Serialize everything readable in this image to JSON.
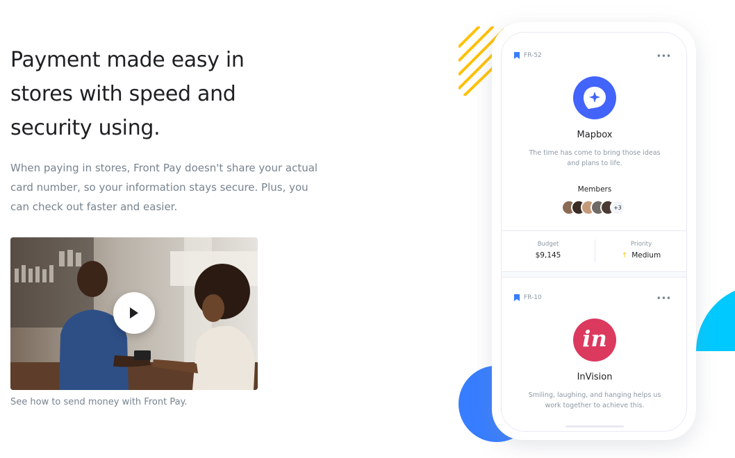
{
  "hero": {
    "headline": "Payment made easy in stores with speed and security using.",
    "lead": "When paying in stores, Front Pay doesn't share your actual card number, so your information stays secure. Plus, you can check out faster and easier.",
    "video_caption": "See how to send money with Front Pay.",
    "play_icon": "play-icon"
  },
  "colors": {
    "primary": "#377dff",
    "cyan": "#00c9ff",
    "yellow": "#ffc107",
    "heading": "#1e2022",
    "muted": "#77838f"
  },
  "phone": {
    "cards": [
      {
        "code": "FR-52",
        "title": "Mapbox",
        "description": "The time has come to bring those ideas and plans to life.",
        "logo_color": "#4264fb",
        "members_label": "Members",
        "members_more": "+3",
        "budget_label": "Budget",
        "budget_value": "$9,145",
        "priority_label": "Priority",
        "priority_value": "Medium"
      },
      {
        "code": "FR-10",
        "title": "InVision",
        "description": "Smiling, laughing, and hanging helps us work together to achieve this.",
        "logo_color": "#dc395f",
        "logo_text": "in"
      }
    ]
  }
}
